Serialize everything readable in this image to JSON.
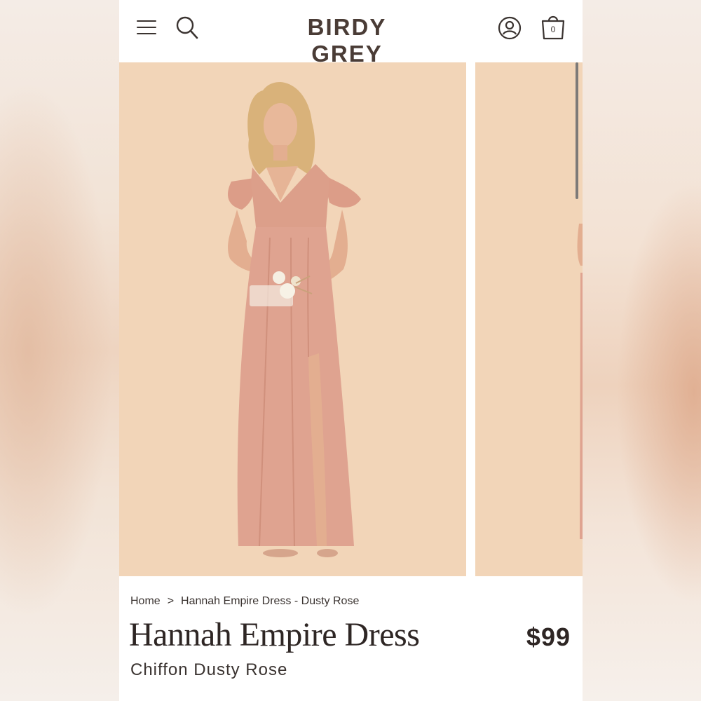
{
  "header": {
    "logo": "BIRDY GREY",
    "bag_count": "0",
    "icons": [
      "menu-icon",
      "search-icon",
      "account-icon",
      "shopping-bag-icon"
    ]
  },
  "gallery": {
    "background_color": "#f2d5b8",
    "dress_color": "#dd9f8a"
  },
  "breadcrumb": {
    "home": "Home",
    "separator": ">",
    "current": "Hannah Empire Dress - Dusty Rose"
  },
  "product": {
    "title": "Hannah Empire Dress",
    "price": "$99",
    "subtitle": "Chiffon Dusty Rose"
  }
}
